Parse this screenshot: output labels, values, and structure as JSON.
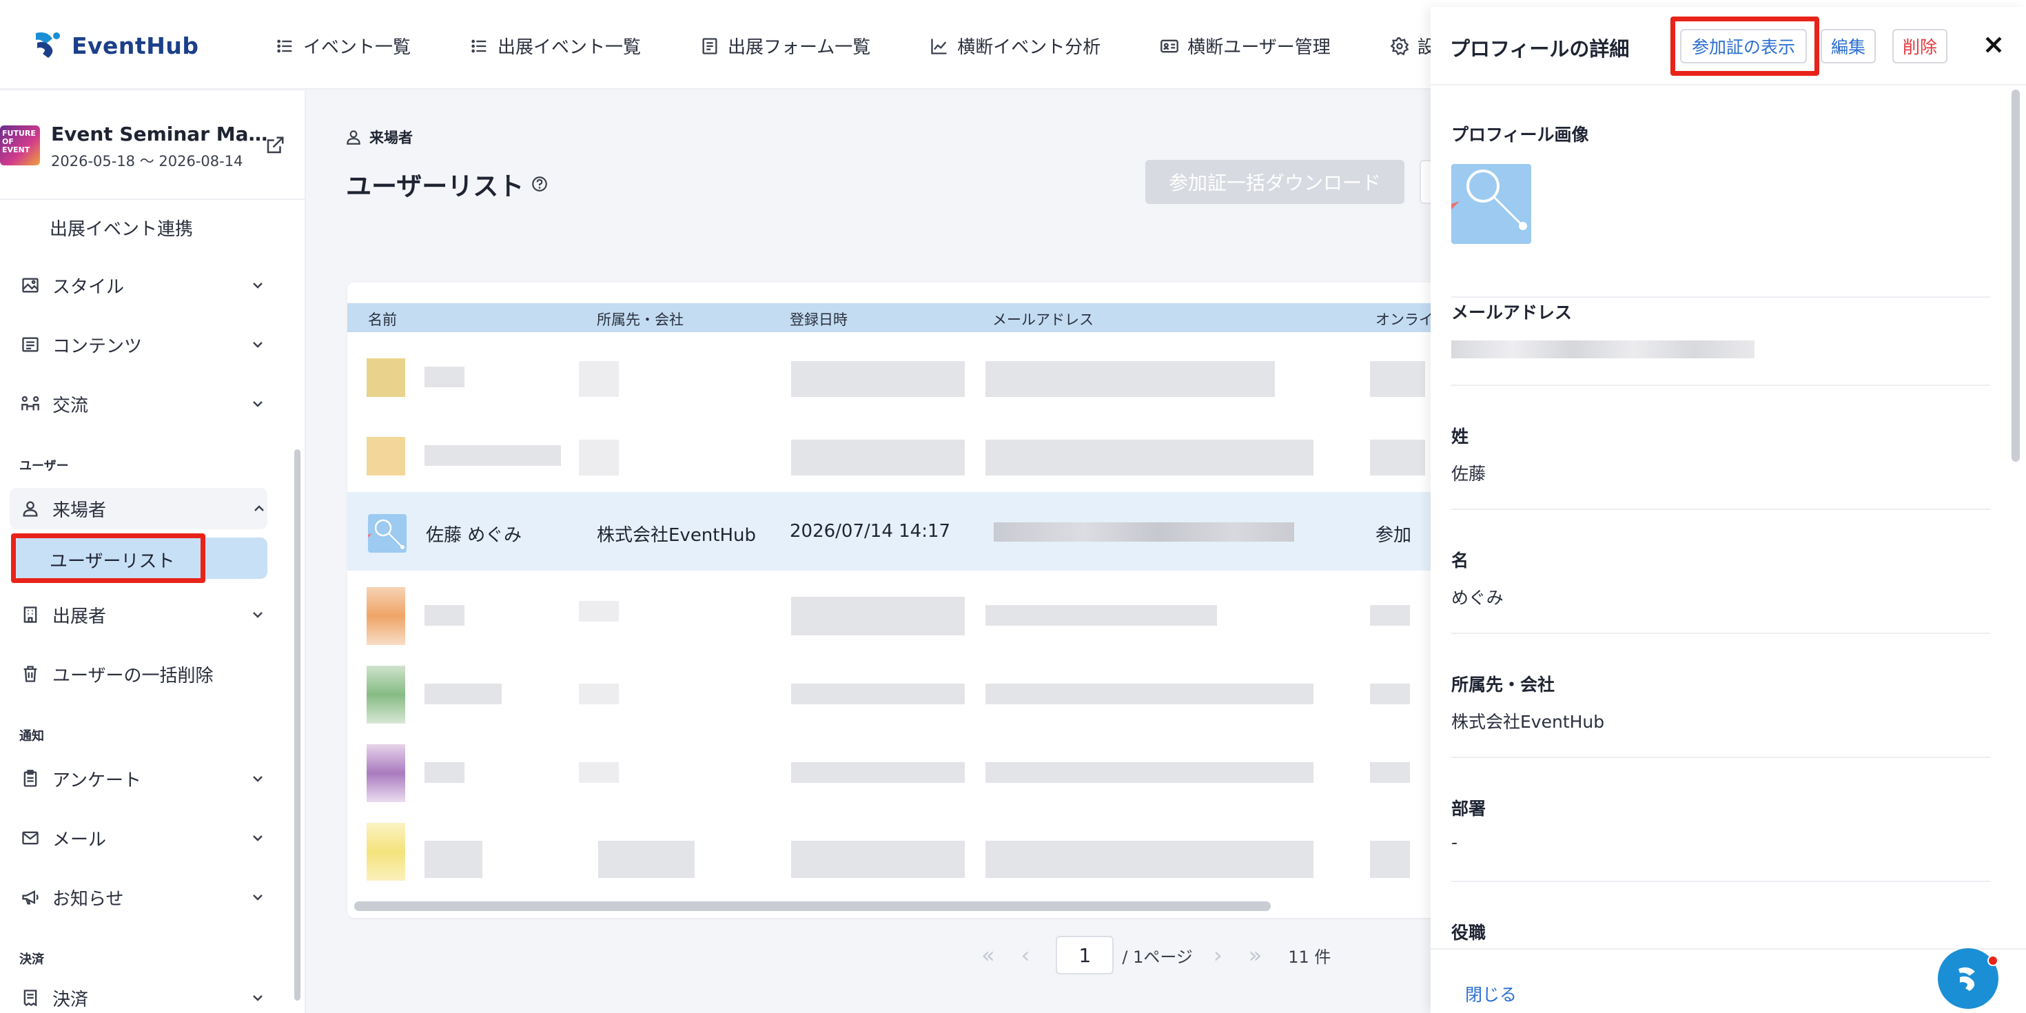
{
  "app": {
    "logo_text": "EventHub"
  },
  "topnav": [
    {
      "label": "イベント一覧",
      "icon": "list-icon"
    },
    {
      "label": "出展イベント一覧",
      "icon": "list-icon"
    },
    {
      "label": "出展フォーム一覧",
      "icon": "form-icon"
    },
    {
      "label": "横断イベント分析",
      "icon": "chart-icon"
    },
    {
      "label": "横断ユーザー管理",
      "icon": "id-card-icon"
    },
    {
      "label": "設定",
      "icon": "gear-icon"
    }
  ],
  "event": {
    "thumb_text": "FUTURE OF EVENT",
    "name": "Event Seminar Ma…",
    "dates": "2026-05-18 ～ 2026-08-14"
  },
  "sidebar": {
    "items": [
      {
        "label": "出展イベント連携"
      },
      {
        "label": "スタイル"
      },
      {
        "label": "コンテンツ"
      },
      {
        "label": "交流"
      },
      {
        "label": "来場者"
      },
      {
        "label": "ユーザーリスト"
      },
      {
        "label": "出展者"
      },
      {
        "label": "ユーザーの一括削除"
      },
      {
        "label": "アンケート"
      },
      {
        "label": "メール"
      },
      {
        "label": "お知らせ"
      },
      {
        "label": "決済"
      }
    ],
    "sections": {
      "users": "ユーザー",
      "notify": "通知",
      "payment": "決済"
    }
  },
  "main": {
    "breadcrumb": "来場者",
    "title": "ユーザーリスト",
    "bulk_download": "参加証一括ダウンロード"
  },
  "table": {
    "columns": [
      "名前",
      "所属先・会社",
      "登録日時",
      "メールアドレス",
      "オンライ"
    ],
    "selected_row": {
      "name": "佐藤 めぐみ",
      "company": "株式会社EventHub",
      "registered": "2026/07/14 14:17",
      "status": "参加"
    }
  },
  "pager": {
    "current_page": "1",
    "total_pages": "/ 1ページ",
    "count": "11 件"
  },
  "drawer": {
    "title": "プロフィールの詳細",
    "show_badge": "参加証の表示",
    "edit": "編集",
    "delete": "削除",
    "fields": {
      "profile_image": "プロフィール画像",
      "email": "メールアドレス",
      "last_name_label": "姓",
      "last_name": "佐藤",
      "first_name_label": "名",
      "first_name": "めぐみ",
      "company_label": "所属先・会社",
      "company": "株式会社EventHub",
      "department_label": "部署",
      "department": "-",
      "position_label": "役職"
    },
    "close": "閉じる"
  },
  "colors": {
    "accent": "#2b6fd1",
    "highlight": "#e8231a",
    "selected_row": "#e5f0fa",
    "header_row": "#c3dcf2"
  }
}
